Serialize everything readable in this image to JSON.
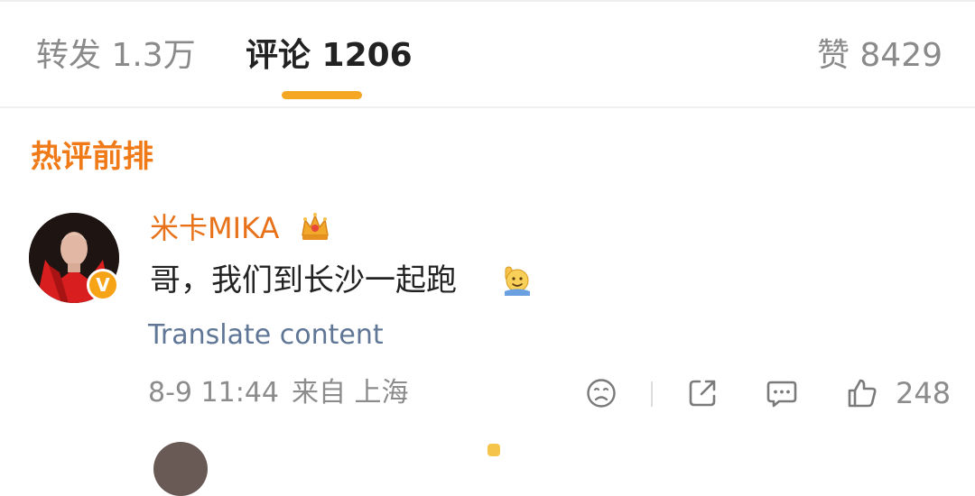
{
  "tabs": {
    "reposts": "转发 1.3万",
    "comments": "评论 1206",
    "likes": "赞 8429"
  },
  "section": {
    "title": "热评前排"
  },
  "comment": {
    "username": "米卡MIKA",
    "badge": "V",
    "text": "哥，我们到长沙一起跑",
    "translate": "Translate content",
    "date": "8-9 11:44",
    "source": "来自 上海",
    "likes": "248"
  },
  "colors": {
    "accent": "#f5a623",
    "section_title": "#f07a18",
    "username": "#e8721a",
    "link": "#5f7696",
    "muted": "#8c8c8c"
  },
  "icons": [
    "crown-icon",
    "waving-emoji-icon",
    "sad-face-icon",
    "share-icon",
    "comment-icon",
    "thumbs-up-icon"
  ]
}
